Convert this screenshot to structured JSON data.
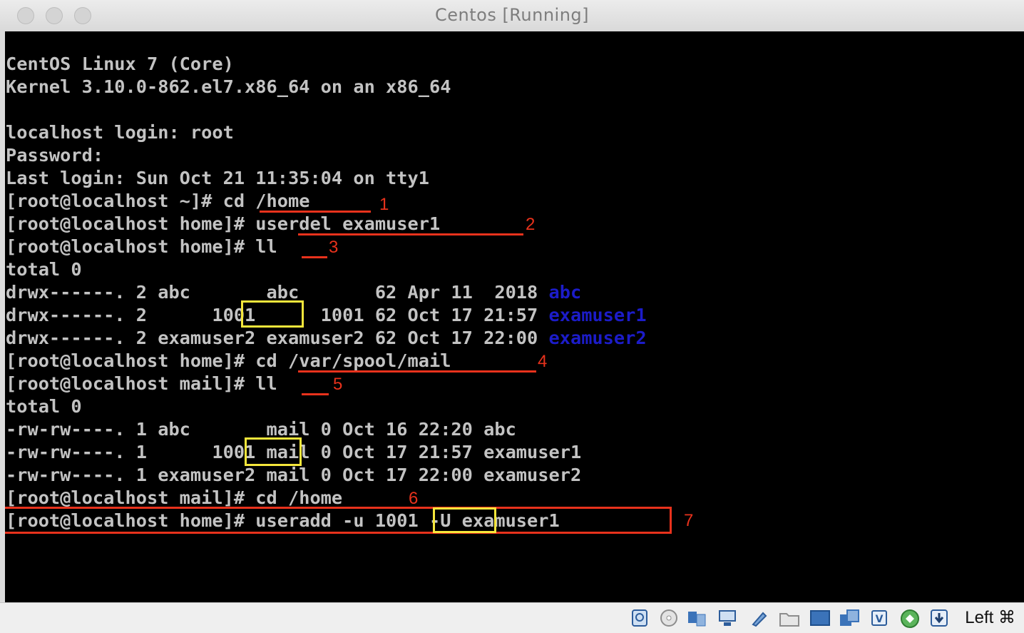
{
  "window": {
    "title": "Centos [Running]"
  },
  "terminal": {
    "lines": [
      "CentOS Linux 7 (Core)",
      "Kernel 3.10.0-862.el7.x86_64 on an x86_64",
      "",
      "localhost login: root",
      "Password:",
      "Last login: Sun Oct 21 11:35:04 on tty1",
      "[root@localhost ~]# cd /home",
      "[root@localhost home]# userdel examuser1",
      "[root@localhost home]# ll",
      "total 0",
      "drwx------. 2 abc       abc       62 Apr 11  2018 ",
      "drwx------. 2      1001      1001 62 Oct 17 21:57 ",
      "drwx------. 2 examuser2 examuser2 62 Oct 17 22:00 ",
      "[root@localhost home]# cd /var/spool/mail",
      "[root@localhost mail]# ll",
      "total 0",
      "-rw-rw----. 1 abc       mail 0 Oct 16 22:20 abc",
      "-rw-rw----. 1      1001 mail 0 Oct 17 21:57 examuser1",
      "-rw-rw----. 1 examuser2 mail 0 Oct 17 22:00 examuser2",
      "[root@localhost mail]# cd /home",
      "[root@localhost home]# useradd -u 1001 -U examuser1"
    ],
    "dir_names": [
      "abc",
      "examuser1",
      "examuser2"
    ],
    "colors": {
      "text": "#c3c3c3",
      "directory": "#1c1cc9",
      "background": "#000000"
    }
  },
  "annotations": {
    "step_numbers": [
      "1",
      "2",
      "3",
      "4",
      "5",
      "6",
      "7"
    ],
    "underline_color": "#e8321c",
    "highlight_box_color": "#f5e63b"
  },
  "statusbar": {
    "icons": [
      "hard-disk-icon",
      "optical-drive-icon",
      "audio-icon",
      "network-icon",
      "usb-icon",
      "shared-folder-icon",
      "display-icon",
      "video-capture-icon",
      "cpu-icon",
      "mouse-integration-icon",
      "download-icon"
    ],
    "host_key": "Left ⌘"
  }
}
